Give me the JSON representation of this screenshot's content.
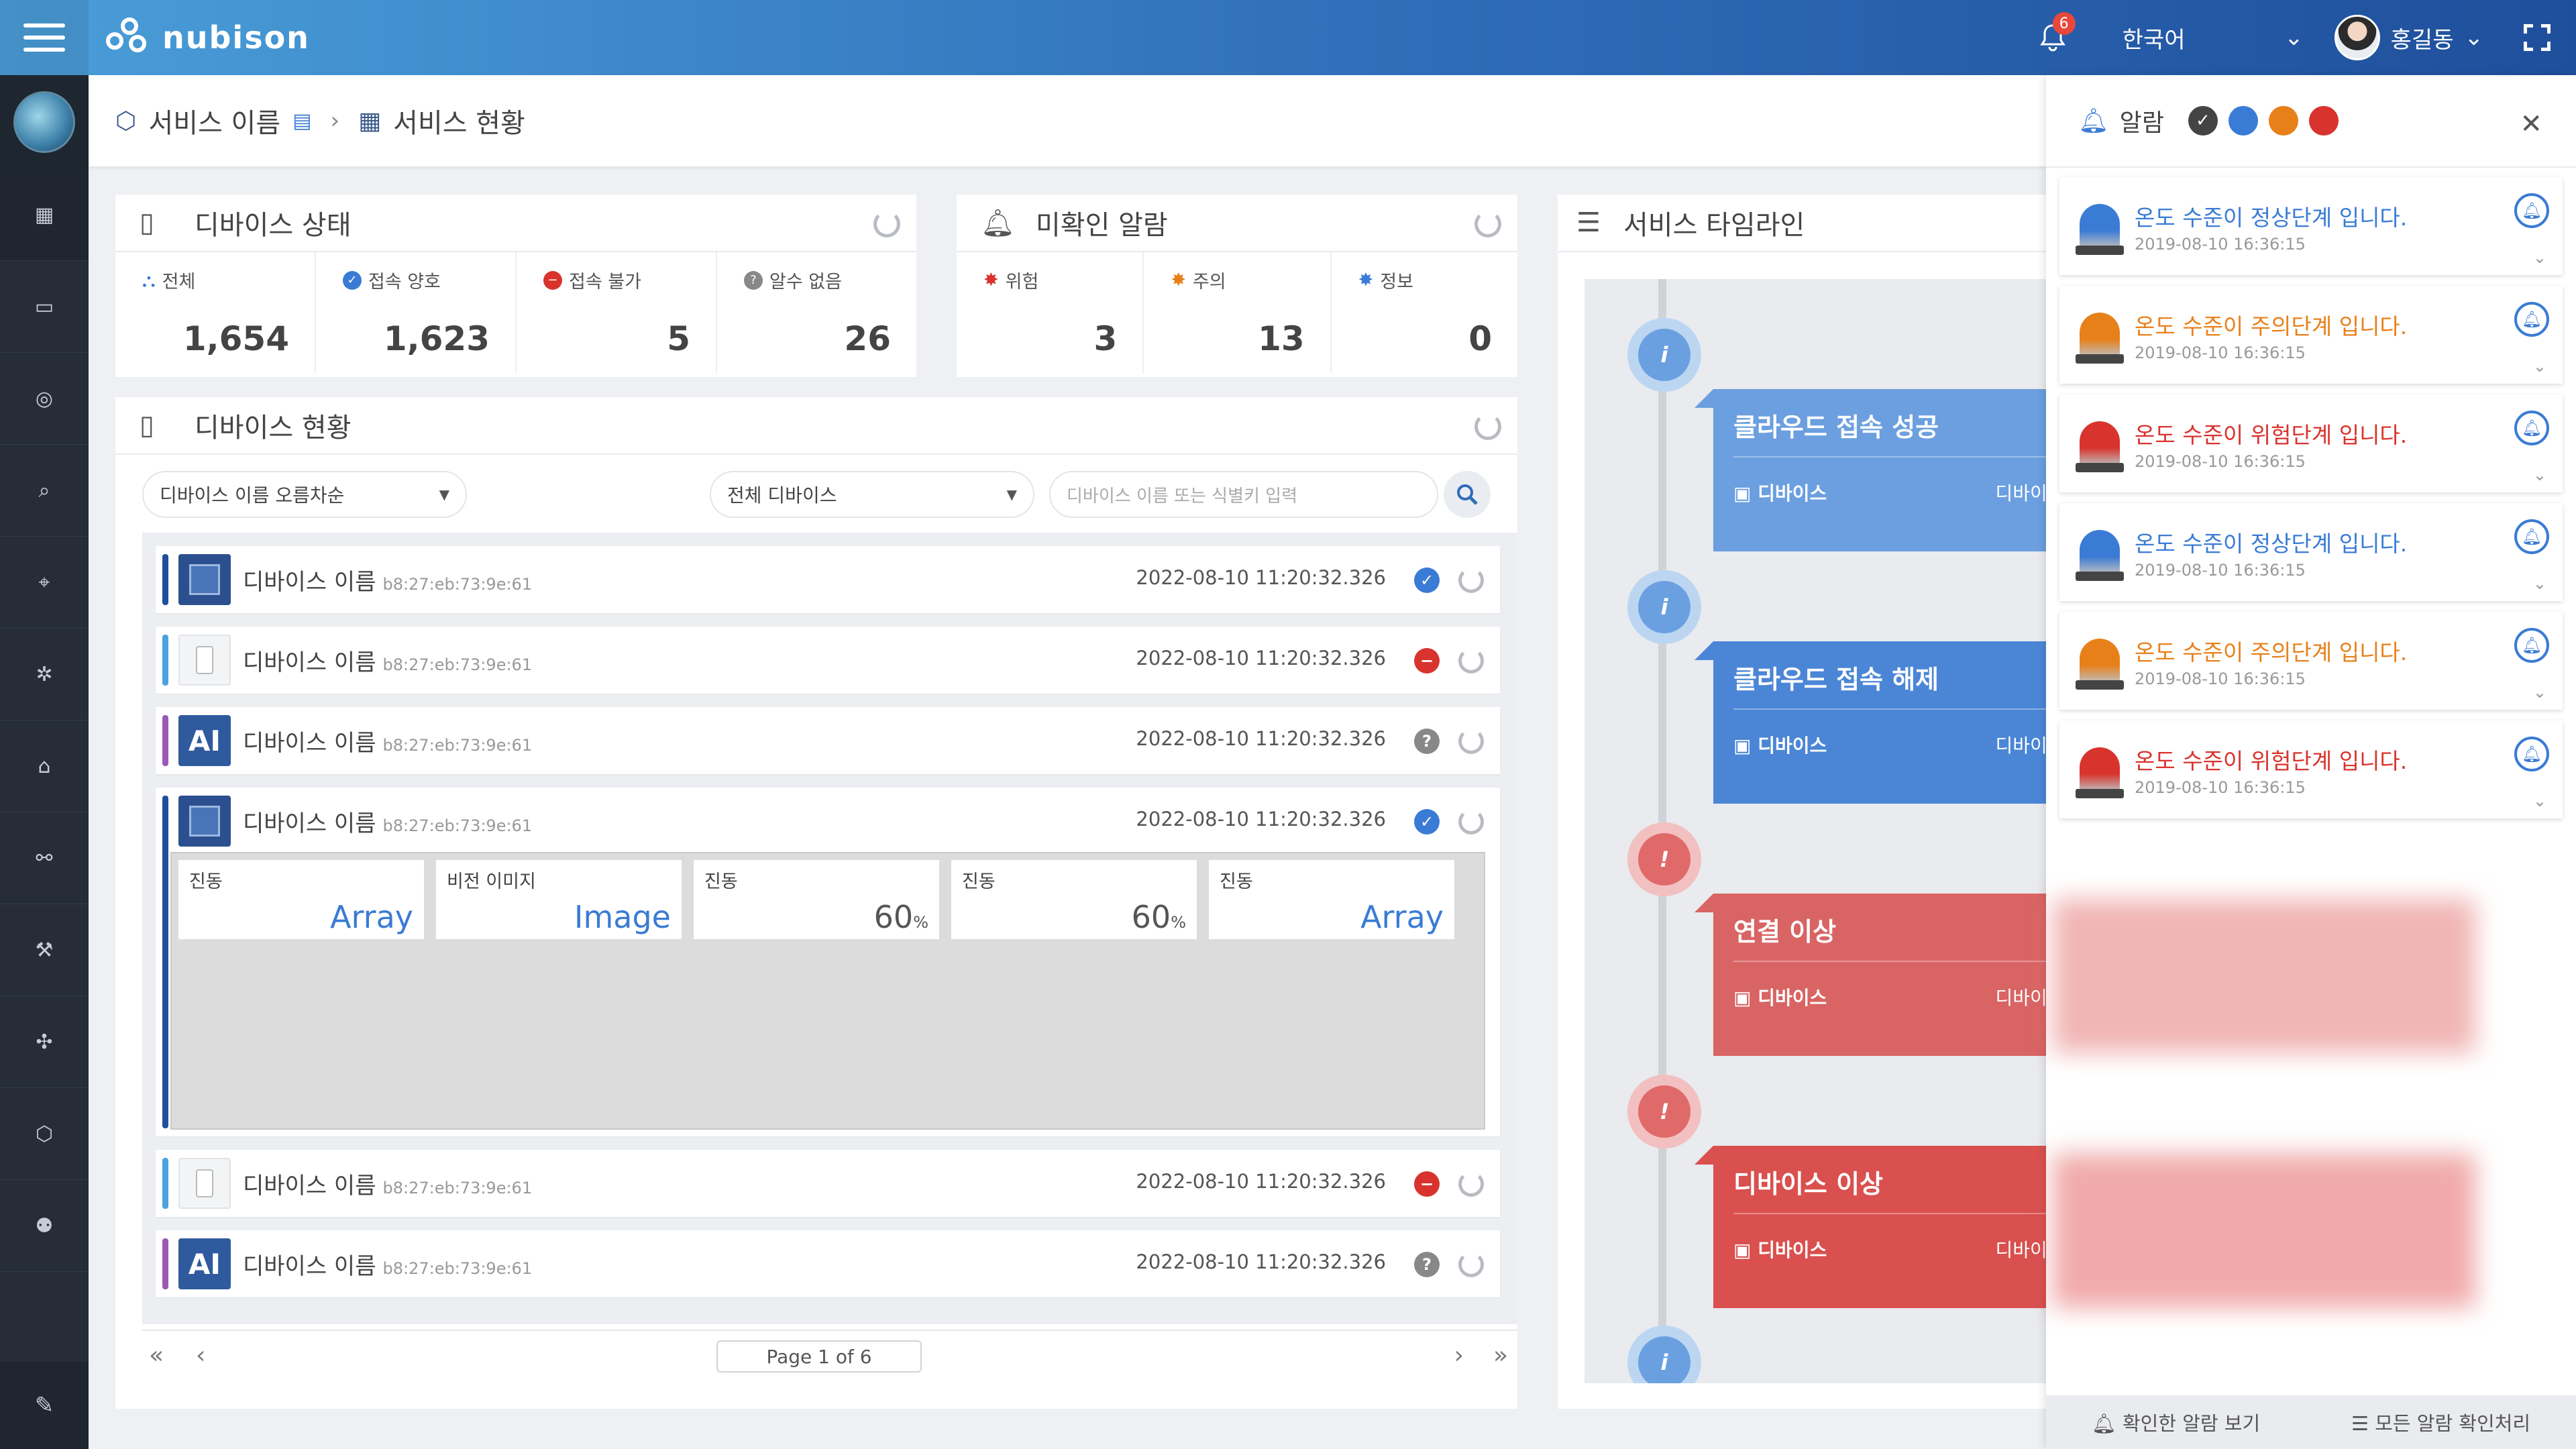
{
  "app": {
    "brand": "nubison"
  },
  "topbar": {
    "notification_count": "6",
    "language": "한국어",
    "user_name": "홍길동"
  },
  "breadcrumb": {
    "service": "서비스 이름",
    "page": "서비스 현황"
  },
  "device_status": {
    "title": "디바이스 상태",
    "items": [
      {
        "label": "전체",
        "value": "1,654"
      },
      {
        "label": "접속 양호",
        "value": "1,623"
      },
      {
        "label": "접속 불가",
        "value": "5"
      },
      {
        "label": "알수 없음",
        "value": "26"
      }
    ]
  },
  "unread_alarms": {
    "title": "미확인 알람",
    "items": [
      {
        "label": "위험",
        "value": "3"
      },
      {
        "label": "주의",
        "value": "13"
      },
      {
        "label": "정보",
        "value": "0"
      }
    ]
  },
  "device_list": {
    "title": "디바이스 현황",
    "sort": "디바이스 이름 오름차순",
    "filter": "전체 디바이스",
    "search_placeholder": "디바이스 이름 또는 식별키 입력",
    "rows": [
      {
        "name": "디바이스 이름",
        "mac": "b8:27:eb:73:9e:61",
        "time": "2022-08-10 11:20:32.326",
        "status": "ok",
        "thumb": "chip",
        "bar": "#1f4f9c"
      },
      {
        "name": "디바이스 이름",
        "mac": "b8:27:eb:73:9e:61",
        "time": "2022-08-10 11:20:32.326",
        "status": "error",
        "thumb": "box",
        "bar": "#4aa3df"
      },
      {
        "name": "디바이스 이름",
        "mac": "b8:27:eb:73:9e:61",
        "time": "2022-08-10 11:20:32.326",
        "status": "unknown",
        "thumb": "AI",
        "bar": "#9b59b6"
      },
      {
        "name": "디바이스 이름",
        "mac": "b8:27:eb:73:9e:61",
        "time": "2022-08-10 11:20:32.326",
        "status": "ok",
        "thumb": "chip",
        "bar": "#1f4f9c"
      },
      {
        "name": "디바이스 이름",
        "mac": "b8:27:eb:73:9e:61",
        "time": "2022-08-10 11:20:32.326",
        "status": "error",
        "thumb": "box",
        "bar": "#4aa3df"
      },
      {
        "name": "디바이스 이름",
        "mac": "b8:27:eb:73:9e:61",
        "time": "2022-08-10 11:20:32.326",
        "status": "unknown",
        "thumb": "AI",
        "bar": "#9b59b6"
      }
    ],
    "expanded_props": [
      {
        "label": "진동",
        "value": "Array",
        "unit": ""
      },
      {
        "label": "비전 이미지",
        "value": "Image",
        "unit": ""
      },
      {
        "label": "진동",
        "value": "60",
        "unit": "%"
      },
      {
        "label": "진동",
        "value": "60",
        "unit": "%"
      },
      {
        "label": "진동",
        "value": "Array",
        "unit": ""
      }
    ],
    "pagination": "Page 1 of 6"
  },
  "timeline": {
    "title": "서비스 타임라인",
    "events": [
      {
        "title": "클라우드 접속 성공",
        "key": "디바이스",
        "value": "디바이스 이름",
        "kind": "info",
        "color": "#6b9fdf"
      },
      {
        "title": "클라우드 접속 해제",
        "key": "디바이스",
        "value": "디바이스 이름",
        "kind": "info",
        "color": "#4b86d6"
      },
      {
        "title": "연결 이상",
        "key": "디바이스",
        "value": "디바이스 이름",
        "kind": "danger",
        "color": "#d96464"
      },
      {
        "title": "디바이스 이상",
        "key": "디바이스",
        "value": "디바이스 이름",
        "kind": "danger",
        "color": "#d9504f"
      }
    ]
  },
  "alarm_panel": {
    "title": "알람",
    "items": [
      {
        "message": "온도 수준이 정상단계 입니다.",
        "time": "2019-08-10 16:36:15",
        "level": "normal",
        "color": "#3a7bd5"
      },
      {
        "message": "온도 수준이 주의단계 입니다.",
        "time": "2019-08-10 16:36:15",
        "level": "warn",
        "color": "#e8801a"
      },
      {
        "message": "온도 수준이 위험단계 입니다.",
        "time": "2019-08-10 16:36:15",
        "level": "danger",
        "color": "#d9332d"
      },
      {
        "message": "온도 수준이 정상단계 입니다.",
        "time": "2019-08-10 16:36:15",
        "level": "normal",
        "color": "#3a7bd5"
      },
      {
        "message": "온도 수준이 주의단계 입니다.",
        "time": "2019-08-10 16:36:15",
        "level": "warn",
        "color": "#e8801a"
      },
      {
        "message": "온도 수준이 위험단계 입니다.",
        "time": "2019-08-10 16:36:15",
        "level": "danger",
        "color": "#d9332d"
      }
    ],
    "view_checked": "확인한 알람 보기",
    "check_all": "모든 알람 확인처리"
  }
}
